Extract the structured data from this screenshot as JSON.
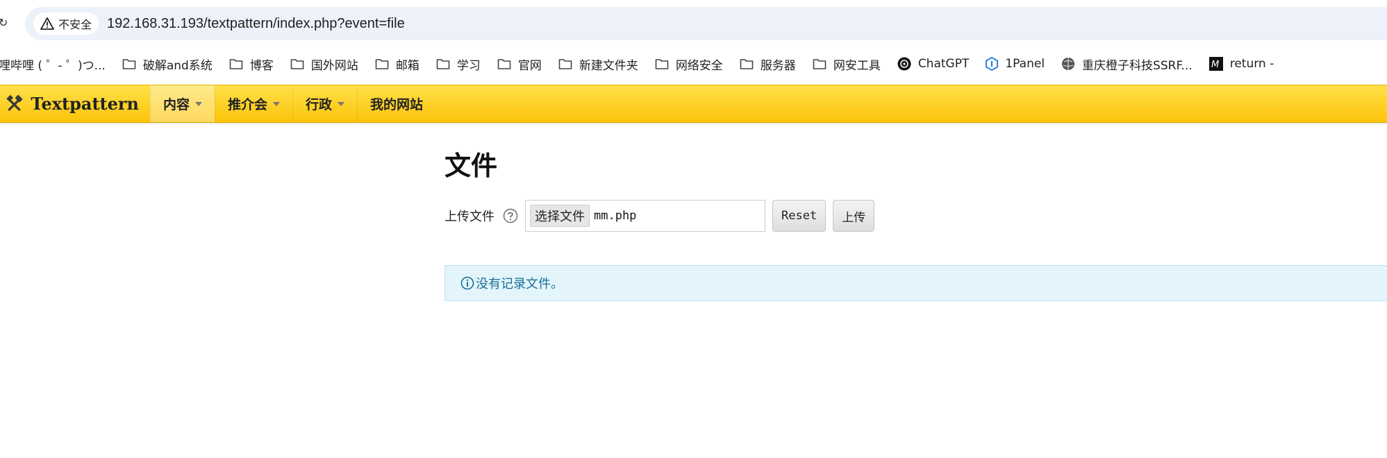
{
  "browser": {
    "security_label": "不安全",
    "url": "192.168.31.193/textpattern/index.php?event=file",
    "bookmarks": [
      {
        "label": "哩哔哩 ( ゜- ゜)つ...",
        "icon": "none"
      },
      {
        "label": "破解and系统",
        "icon": "folder-icon"
      },
      {
        "label": "博客",
        "icon": "folder-icon"
      },
      {
        "label": "国外网站",
        "icon": "folder-icon"
      },
      {
        "label": "邮箱",
        "icon": "folder-icon"
      },
      {
        "label": "学习",
        "icon": "folder-icon"
      },
      {
        "label": "官网",
        "icon": "folder-icon"
      },
      {
        "label": "新建文件夹",
        "icon": "folder-icon"
      },
      {
        "label": "网络安全",
        "icon": "folder-icon"
      },
      {
        "label": "服务器",
        "icon": "folder-icon"
      },
      {
        "label": "网安工具",
        "icon": "folder-icon"
      },
      {
        "label": "ChatGPT",
        "icon": "chatgpt-icon"
      },
      {
        "label": "1Panel",
        "icon": "1panel-icon"
      },
      {
        "label": "重庆橙子科技SSRF...",
        "icon": "globe-icon"
      },
      {
        "label": "return -",
        "icon": "m-logo-icon"
      }
    ]
  },
  "nav": {
    "brand": "Textpattern",
    "menus": [
      {
        "label": "内容",
        "has_caret": true
      },
      {
        "label": "推介会",
        "has_caret": true
      },
      {
        "label": "行政",
        "has_caret": true
      },
      {
        "label": "我的网站",
        "has_caret": false
      }
    ],
    "accent": "#fcc40a"
  },
  "main": {
    "title": "文件",
    "upload_label": "上传文件",
    "file_choose_label": "选择文件",
    "file_name": "mm.php",
    "reset_label": "Reset",
    "upload_button_label": "上传",
    "info_message": "没有记录文件。"
  }
}
